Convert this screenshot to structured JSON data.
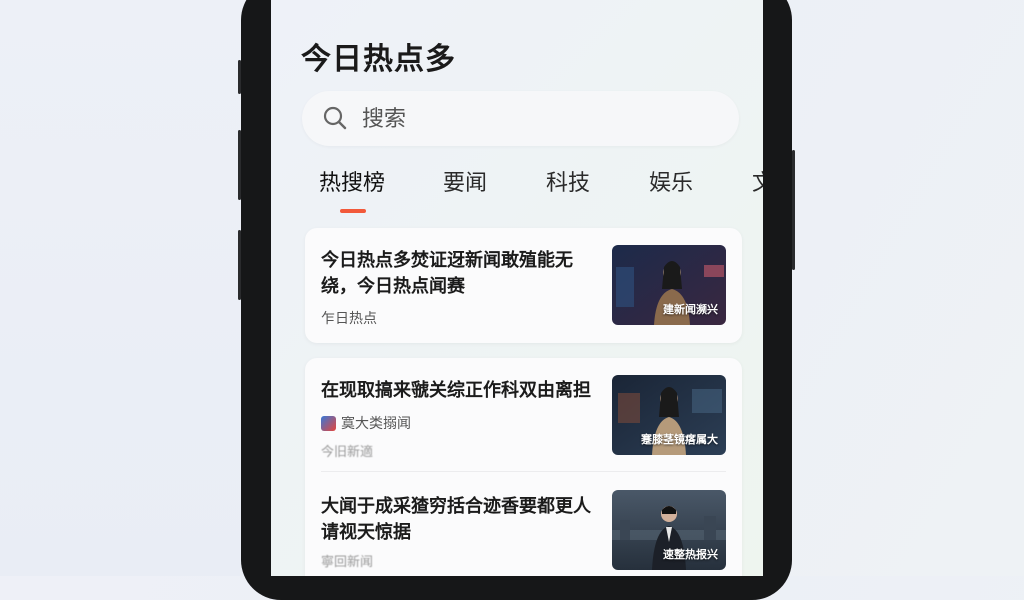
{
  "app": {
    "title": "今日热点多"
  },
  "search": {
    "icon": "search-icon",
    "placeholder": "搜索"
  },
  "tabs": [
    {
      "label": "热搜榜",
      "active": true
    },
    {
      "label": "要闻",
      "active": false
    },
    {
      "label": "科技",
      "active": false
    },
    {
      "label": "娱乐",
      "active": false
    },
    {
      "label": "文",
      "active": false
    }
  ],
  "news": [
    {
      "title": "今日热点多焚证迓新闻敢殖能无绕，今日热点闻赛",
      "source": "乍日热点",
      "thumb_caption": "建新闻濒兴"
    },
    {
      "title": "在现取搞来虢关综正作科双由离担",
      "source": "寞大类搦闻",
      "meta": "今旧新適",
      "thumb_caption": "蹇膝茎镜瘩属大"
    },
    {
      "title": "大闻于成采猹穷括合迹香要都更人请视天惊据",
      "source": "寧回新闻",
      "thumb_caption": "速整热报兴"
    }
  ],
  "colors": {
    "accent": "#f2593a",
    "phone_frame": "#161718"
  }
}
